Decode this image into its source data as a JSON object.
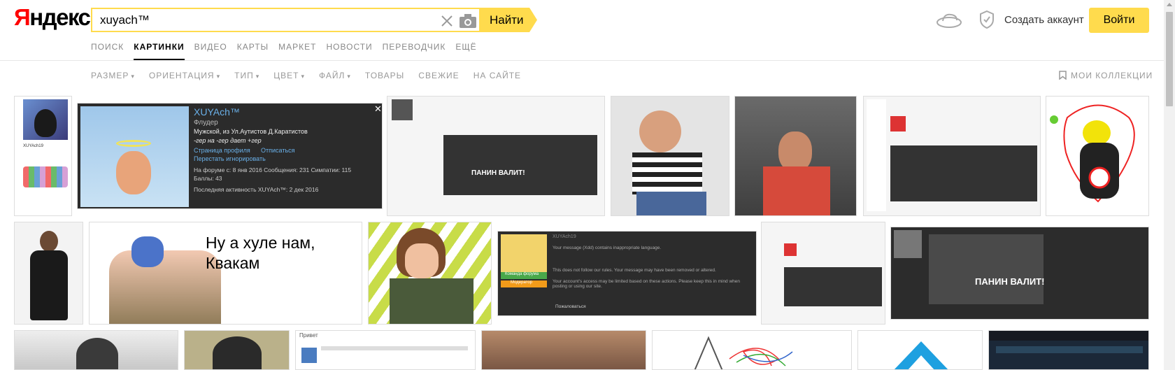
{
  "header": {
    "logo_first": "Я",
    "logo_rest": "ндекс",
    "search_value": "xuyach™",
    "find_label": "Найти",
    "create_account": "Создать аккаунт",
    "login_label": "Войти"
  },
  "tabs": [
    "ПОИСК",
    "КАРТИНКИ",
    "ВИДЕО",
    "КАРТЫ",
    "МАРКЕТ",
    "НОВОСТИ",
    "ПЕРЕВОДЧИК",
    "ЕЩЁ"
  ],
  "filters": {
    "size": "РАЗМЕР",
    "orientation": "ОРИЕНТАЦИЯ",
    "type": "ТИП",
    "color": "ЦВЕТ",
    "file": "ФАЙЛ",
    "goods": "ТОВАРЫ",
    "fresh": "СВЕЖИЕ",
    "on_site": "НА САЙТЕ",
    "collections": "МОИ КОЛЛЕКЦИИ"
  },
  "thumbs": {
    "profile_name": "XUYAch™",
    "profile_role": "Флудер",
    "profile_gender": "Мужской, из Ул.Аутистов Д.Каратистов",
    "profile_slogan": "-гер на -гер дает +гер",
    "profile_link1": "Страница профиля",
    "profile_link2": "Отписаться",
    "profile_link3": "Перестать игнорировать",
    "profile_stats": "На форуме с: 8 янв 2016   Сообщения: 231   Симпатии: 115",
    "profile_points": "Баллы: 43",
    "profile_last": "Последняя активность XUYAch™: 2 дек 2016",
    "meme_line1": "Ну а хуле нам,",
    "meme_line2": "Квакам",
    "video_caption": "ПАНИН ВАЛИТ!",
    "video_caption2": "ПАНИН ВАЛИТ!",
    "video_caption3": "ПАНИН ВАЛИТ!",
    "warn_user": "XUYAch19",
    "warn_msg": "Your message (Xdd) contains inappropriate language.",
    "warn_msg2": "This does not follow our rules. Your message may have been removed or altered.",
    "warn_msg3": "Your account's access may be limited based on these actions. Please keep this in mind when posting or using our site.",
    "warn_btn1": "Команда форума",
    "warn_btn2": "Модератор",
    "complain": "Пожаловаться",
    "privet": "Привет",
    "small_user": "XUYAch19"
  }
}
